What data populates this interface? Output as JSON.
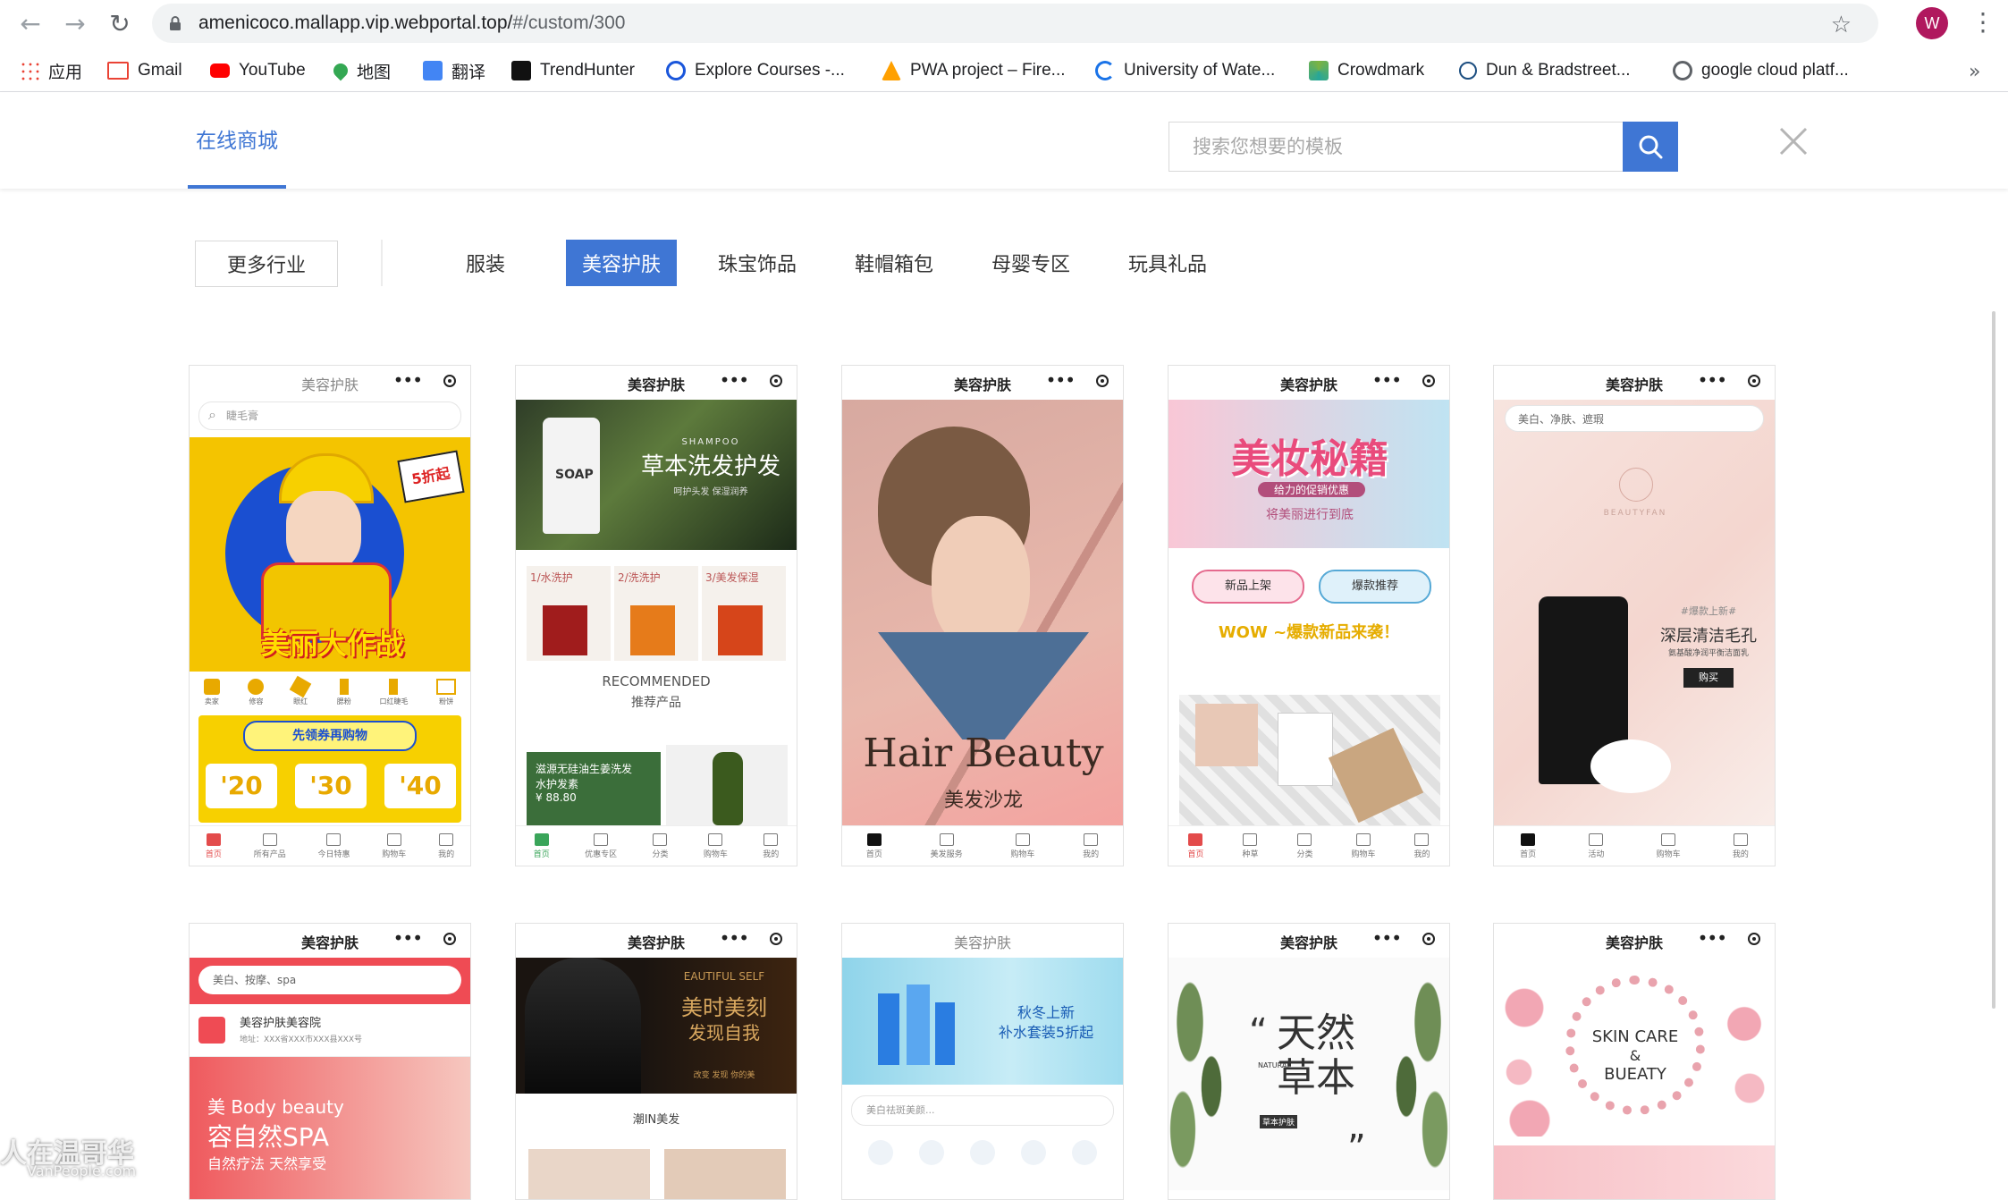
{
  "browser": {
    "url_host": "amenicoco.mallapp.vip.webportal.top/",
    "url_path": "#/custom/300",
    "profile_initial": "W",
    "bookmarks": [
      {
        "label": "应用",
        "icon": "apps-grid-icon"
      },
      {
        "label": "Gmail",
        "icon": "gmail-icon"
      },
      {
        "label": "YouTube",
        "icon": "youtube-icon"
      },
      {
        "label": "地图",
        "icon": "maps-pin-icon"
      },
      {
        "label": "翻译",
        "icon": "translate-icon"
      },
      {
        "label": "TrendHunter",
        "icon": "trendhunter-icon"
      },
      {
        "label": "Explore Courses -...",
        "icon": "courses-icon"
      },
      {
        "label": "PWA project – Fire...",
        "icon": "firebase-icon"
      },
      {
        "label": "University of Wate...",
        "icon": "university-icon"
      },
      {
        "label": "Crowdmark",
        "icon": "crowdmark-icon"
      },
      {
        "label": "Dun & Bradstreet...",
        "icon": "dnb-icon"
      },
      {
        "label": "google cloud platf...",
        "icon": "gcp-icon"
      }
    ],
    "more_bookmarks": "»"
  },
  "header": {
    "tab_label": "在线商城",
    "search_placeholder": "搜索您想要的模板"
  },
  "categories": {
    "more_label": "更多行业",
    "items": [
      {
        "label": "服装",
        "active": false
      },
      {
        "label": "美容护肤",
        "active": true
      },
      {
        "label": "珠宝饰品",
        "active": false
      },
      {
        "label": "鞋帽箱包",
        "active": false
      },
      {
        "label": "母婴专区",
        "active": false
      },
      {
        "label": "玩具礼品",
        "active": false
      }
    ]
  },
  "cards": [
    {
      "title": "美容护肤",
      "search": "睫毛膏",
      "banner_big": "美丽大作战",
      "badge": "5折起",
      "icons": [
        "卖家",
        "修容",
        "眼红",
        "腮粉",
        "口红睫毛",
        "粉饼"
      ],
      "coupon_title": "先领券再购物",
      "coupons": [
        "'20",
        "'30",
        "'40"
      ],
      "nav": [
        "首页",
        "所有产品",
        "今日特惠",
        "购物车",
        "我的"
      ]
    },
    {
      "title": "美容护肤",
      "banner_en": "SHAMPOO",
      "banner_big": "草本洗发护发",
      "banner_small": "呵护头发 保湿润养",
      "bottle_label": "SOAP",
      "steps": [
        "1/水洗护",
        "2/洗洗护",
        "3/美发保湿"
      ],
      "recommended_en": "RECOMMENDED",
      "recommended_cn": "推荐产品",
      "promo_line1": "滋源无硅油生姜洗发",
      "promo_line2": "水护发素",
      "promo_price": "¥ 88.80",
      "nav": [
        "首页",
        "优惠专区",
        "分类",
        "购物车",
        "我的"
      ]
    },
    {
      "title": "美容护肤",
      "hero_en": "Hair Beauty",
      "hero_cn": "美发沙龙",
      "nav": [
        "首页",
        "美发服务",
        "购物车",
        "我的"
      ]
    },
    {
      "title": "美容护肤",
      "banner_big": "美妆秘籍",
      "banner_sub": "给力的促销优惠",
      "banner_small": "将美丽进行到底",
      "btn_new": "新品上架",
      "btn_hot": "爆款推荐",
      "wow_line": "WOW ~爆款新品来袭！",
      "nav": [
        "首页",
        "种草",
        "分类",
        "购物车",
        "我的"
      ]
    },
    {
      "title": "美容护肤",
      "search": "美白、净肤、遮瑕",
      "brand": "BEAUTYFAN",
      "promo_tag": "#爆款上新#",
      "promo_big": "深层清洁毛孔",
      "promo_small": "氨基酸净润平衡洁面乳",
      "buy": "购买",
      "nav": [
        "首页",
        "活动",
        "购物车",
        "我的"
      ]
    },
    {
      "title": "美容护肤",
      "search": "美白、按摩、spa",
      "shop_name": "美容护肤美容院",
      "shop_addr": "地址：XXX省XXX市XXX县XXX号",
      "hero_line1": "美 Body beauty",
      "hero_line2": "容自然SPA",
      "hero_line3": "自然疗法 天然享受"
    },
    {
      "title": "美容护肤",
      "banner_en": "EAUTIFUL SELF",
      "banner_line1": "美时美刻",
      "banner_line2": "发现自我",
      "banner_small": "改变 发现 你的美",
      "section": "潮IN美发"
    },
    {
      "title": "美容护肤",
      "banner_line1": "秋冬上新",
      "banner_line2": "补水套装5折起",
      "search": "美白祛斑美颜..."
    },
    {
      "title": "美容护肤",
      "quote_open": "“",
      "big_chars": "天然草本",
      "natural": "NATURAL",
      "tag": "草本护肤",
      "quote_close": "”"
    },
    {
      "title": "美容护肤",
      "line1": "SKIN CARE",
      "line2": "&",
      "line3": "BUEATY"
    }
  ],
  "watermark": {
    "text": "人在温哥华",
    "sub": "VanPeople.com"
  },
  "colors": {
    "accent": "#3f76d4",
    "chrome_bg": "#f1f3f4"
  }
}
